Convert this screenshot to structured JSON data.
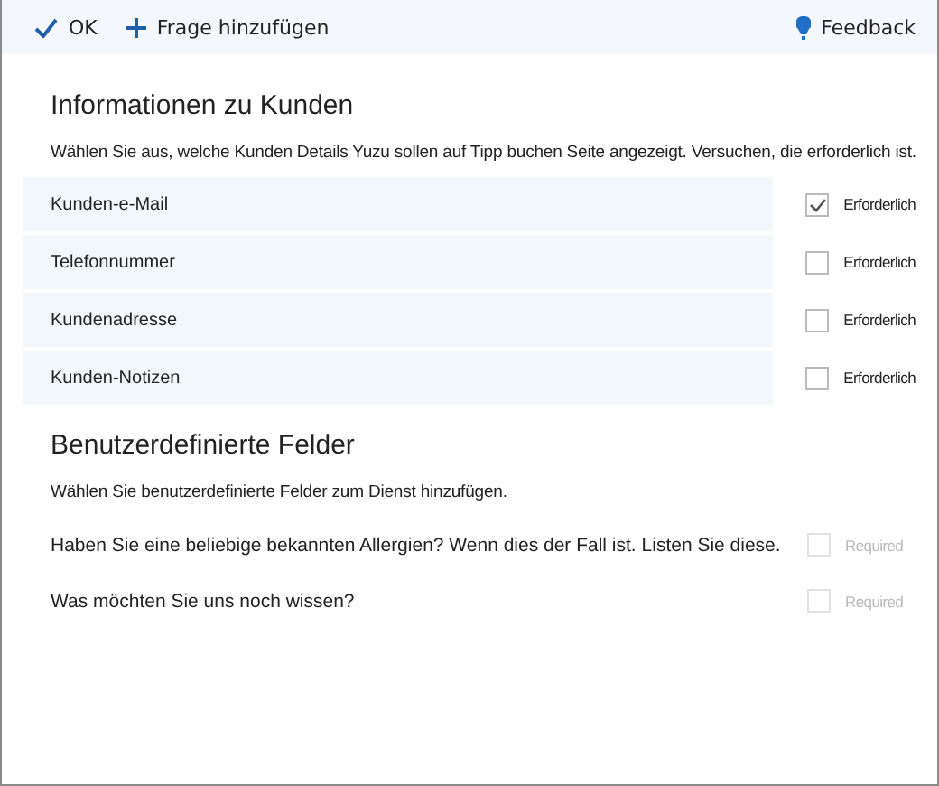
{
  "toolbar": {
    "actions": [
      {
        "kind": "check",
        "label": "OK"
      },
      {
        "kind": "plus",
        "label": "Frage hinzufügen"
      }
    ],
    "feedback": "Feedback"
  },
  "customer_info": {
    "title": "Informationen zu Kunden",
    "description": "Wählen Sie aus, welche Kunden Details Yuzu sollen auf Tipp buchen Seite angezeigt. Versuchen, die erforderlich ist.",
    "fields": [
      {
        "label": "Kunden-e-Mail",
        "checked": true,
        "required_label": "Erforderlich"
      },
      {
        "label": "Telefonnummer",
        "checked": false,
        "required_label": "Erforderlich"
      },
      {
        "label": "Kundenadresse",
        "checked": false,
        "required_label": "Erforderlich"
      },
      {
        "label": "Kunden-Notizen",
        "checked": false,
        "required_label": "Erforderlich"
      }
    ]
  },
  "custom_fields": {
    "title": "Benutzerdefinierte Felder",
    "description": "Wählen Sie benutzerdefinierte Felder zum Dienst hinzufügen.",
    "fields": [
      {
        "label": "Haben Sie eine beliebige bekannten Allergien? Wenn dies der Fall ist. Listen Sie diese.",
        "checked": false,
        "disabled": true,
        "required_label": "Required"
      },
      {
        "label": "Was möchten Sie uns noch wissen?",
        "checked": false,
        "disabled": true,
        "required_label": "Required"
      }
    ]
  }
}
